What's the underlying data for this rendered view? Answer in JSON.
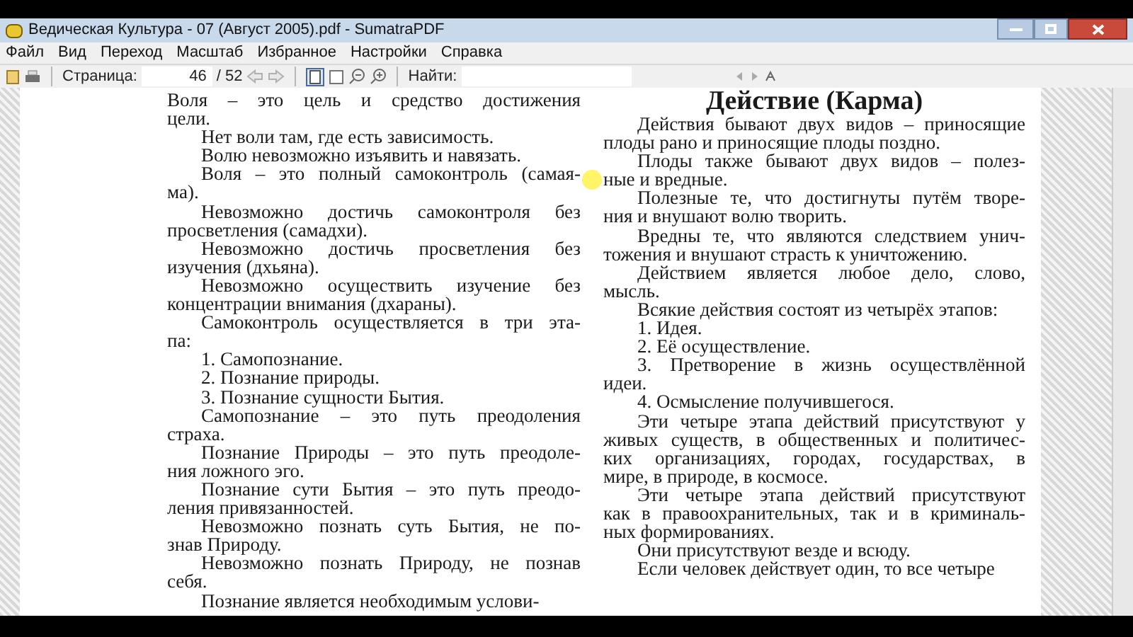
{
  "window": {
    "title": "Ведическая Культура - 07 (Август 2005).pdf - SumatraPDF"
  },
  "menu": [
    {
      "label": "Файл"
    },
    {
      "label": "Вид"
    },
    {
      "label": "Переход"
    },
    {
      "label": "Масштаб"
    },
    {
      "label": "Избранное"
    },
    {
      "label": "Настройки"
    },
    {
      "label": "Справка"
    }
  ],
  "toolbar": {
    "page_label": "Страница:",
    "page_value": "46",
    "page_total": "/ 52",
    "find_label": "Найти:"
  },
  "document": {
    "left_column": [
      {
        "indent": false,
        "lines": [
          "Воля – это цель и средство достижения",
          "цели."
        ]
      },
      {
        "indent": true,
        "lines": [
          "Нет воли там, где есть зависимость."
        ]
      },
      {
        "indent": true,
        "lines": [
          "Волю невозможно изъявить и навязать."
        ]
      },
      {
        "indent": true,
        "lines": [
          "Воля – это полный самоконтроль (самая-",
          "ма)."
        ]
      },
      {
        "indent": true,
        "lines": [
          "Невозможно достичь самоконтроля без",
          "просветления (самадхи)."
        ]
      },
      {
        "indent": true,
        "lines": [
          "Невозможно достичь просветления без",
          "изучения (дхьяна)."
        ]
      },
      {
        "indent": true,
        "lines": [
          "Невозможно осуществить изучение без",
          "концентрации внимания (дхараны)."
        ]
      },
      {
        "indent": true,
        "lines": [
          "Самоконтроль осуществляется в три эта-",
          "па:"
        ]
      },
      {
        "indent": true,
        "lines": [
          "1. Самопознание."
        ]
      },
      {
        "indent": true,
        "lines": [
          "2. Познание природы."
        ]
      },
      {
        "indent": true,
        "lines": [
          "3. Познание сущности Бытия."
        ]
      },
      {
        "indent": true,
        "lines": [
          "Самопознание – это путь преодоления",
          "страха."
        ]
      },
      {
        "indent": true,
        "lines": [
          "Познание Природы – это путь преодоле-",
          "ния ложного эго."
        ]
      },
      {
        "indent": true,
        "lines": [
          "Познание сути Бытия – это путь преодо-",
          "ления привязанностей."
        ]
      },
      {
        "indent": true,
        "lines": [
          "Невозможно познать суть Бытия, не по-",
          "знав Природу."
        ]
      },
      {
        "indent": true,
        "lines": [
          "Невозможно познать Природу, не познав",
          "себя."
        ]
      },
      {
        "indent": true,
        "lines": [
          "Познание является необходимым услови-"
        ]
      }
    ],
    "right_heading": "Действие (Карма)",
    "right_column": [
      {
        "indent": true,
        "lines": [
          "Действия бывают двух видов – приносящие",
          "плоды рано и приносящие плоды поздно."
        ]
      },
      {
        "indent": true,
        "lines": [
          "Плоды также бывают двух видов – полез-",
          "ные и вредные."
        ]
      },
      {
        "indent": true,
        "lines": [
          "Полезные те, что достигнуты путём творе-",
          "ния и внушают волю творить."
        ]
      },
      {
        "indent": true,
        "lines": [
          "Вредны те, что являются следствием унич-",
          "тожения и внушают страсть к уничтожению."
        ]
      },
      {
        "indent": true,
        "lines": [
          "Действием является любое дело, слово,",
          "мысль."
        ]
      },
      {
        "indent": true,
        "lines": [
          "Всякие действия состоят из четырёх этапов:"
        ]
      },
      {
        "indent": true,
        "lines": [
          "1. Идея."
        ]
      },
      {
        "indent": true,
        "lines": [
          "2. Её осуществление."
        ]
      },
      {
        "indent": true,
        "lines": [
          "3. Претворение в жизнь осуществлённой",
          "идеи."
        ]
      },
      {
        "indent": true,
        "lines": [
          "4. Осмысление получившегося."
        ]
      },
      {
        "indent": true,
        "lines": [
          "Эти четыре этапа действий присутствуют у",
          "живых существ, в общественных и политичес-",
          "ких организациях, городах, государствах, в",
          "мире, в природе, в космосе."
        ]
      },
      {
        "indent": true,
        "lines": [
          "Эти четыре этапа действий присутствуют",
          "как в правоохранительных, так и в криминаль-",
          "ных формированиях."
        ]
      },
      {
        "indent": true,
        "lines": [
          "Они присутствуют везде и всюду."
        ]
      },
      {
        "indent": true,
        "lines": [
          "Если человек действует один, то все четыре"
        ]
      }
    ]
  }
}
